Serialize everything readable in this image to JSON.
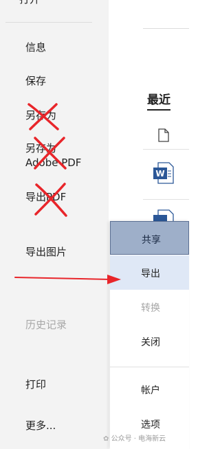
{
  "left_menu": {
    "top_partial": "打开",
    "items": [
      {
        "label": "信息"
      },
      {
        "label": "保存"
      },
      {
        "label": "另存为"
      },
      {
        "label_line1": "另存为",
        "label_line2": "Adobe PDF"
      },
      {
        "label": "导出PDF"
      },
      {
        "label": "导出图片"
      },
      {
        "label": "历史记录"
      },
      {
        "label": "打印"
      },
      {
        "label": "更多..."
      }
    ]
  },
  "right_panel": {
    "recent_title": "最近"
  },
  "popup_menu": {
    "share": "共享",
    "export": "导出",
    "convert": "转换",
    "close": "关闭",
    "account": "帐户",
    "options": "选项"
  },
  "watermark": {
    "text": "公众号 · 电海新云"
  },
  "colors": {
    "annotation_red": "#e8252a",
    "share_bg": "#9eafc9",
    "export_bg": "#dfe8f6",
    "word_blue": "#2b5797"
  }
}
